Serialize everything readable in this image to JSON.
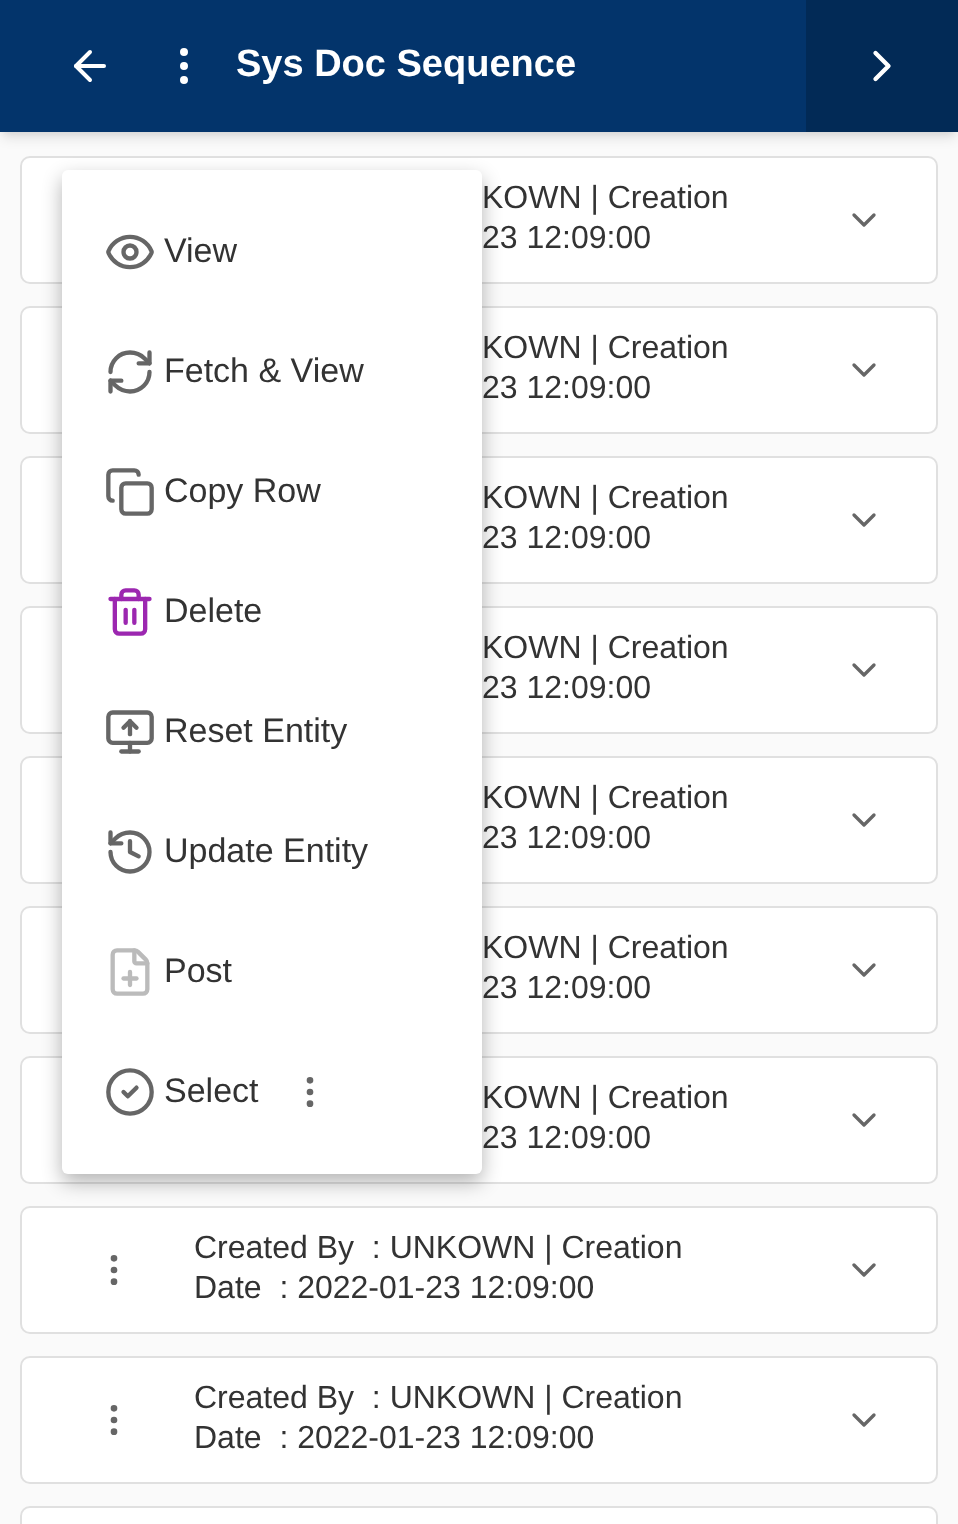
{
  "header": {
    "title": "Sys Doc Sequence"
  },
  "rows": [
    {
      "kind": "covered",
      "line1": "KOWN | Creation",
      "line2": "23 12:09:00"
    },
    {
      "kind": "covered",
      "line1": "KOWN | Creation",
      "line2": "23 12:09:00"
    },
    {
      "kind": "covered",
      "line1": "KOWN | Creation",
      "line2": "23 12:09:00"
    },
    {
      "kind": "covered",
      "line1": "KOWN | Creation",
      "line2": "23 12:09:00"
    },
    {
      "kind": "covered",
      "line1": "KOWN | Creation",
      "line2": "23 12:09:00"
    },
    {
      "kind": "covered",
      "line1": "KOWN | Creation",
      "line2": "23 12:09:00"
    },
    {
      "kind": "covered",
      "line1": "KOWN | Creation",
      "line2": "23 12:09:00"
    },
    {
      "kind": "full",
      "line1": "Created By  : UNKOWN | Creation",
      "line2": "Date  : 2022-01-23 12:09:00"
    },
    {
      "kind": "full",
      "line1": "Created By  : UNKOWN | Creation",
      "line2": "Date  : 2022-01-23 12:09:00"
    }
  ],
  "menu": [
    {
      "kind": "view",
      "label": "View"
    },
    {
      "kind": "fetch",
      "label": "Fetch & View"
    },
    {
      "kind": "copy",
      "label": "Copy Row"
    },
    {
      "kind": "delete",
      "label": "Delete"
    },
    {
      "kind": "reset",
      "label": "Reset Entity"
    },
    {
      "kind": "update",
      "label": "Update Entity"
    },
    {
      "kind": "post",
      "label": "Post"
    },
    {
      "kind": "select",
      "label": "Select"
    }
  ]
}
